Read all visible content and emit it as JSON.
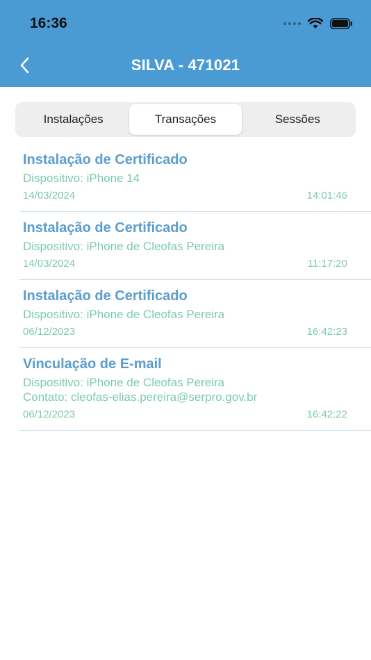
{
  "status": {
    "time": "16:36"
  },
  "header": {
    "title": "SILVA - 471021"
  },
  "tabs": [
    {
      "label": "Instalações"
    },
    {
      "label": "Transações"
    },
    {
      "label": "Sessões"
    }
  ],
  "active_tab": "Transações",
  "colors": {
    "header": "#4a9ad4",
    "title": "#5b9dcf",
    "detail": "#7ccba9"
  },
  "items": [
    {
      "title": "Instalação de Certificado",
      "device": "Dispositivo: iPhone 14",
      "date": "14/03/2024",
      "time": "14:01:46"
    },
    {
      "title": "Instalação de Certificado",
      "device": "Dispositivo: iPhone de Cleofas Pereira",
      "date": "14/03/2024",
      "time": "11:17:20"
    },
    {
      "title": "Instalação de Certificado",
      "device": "Dispositivo: iPhone de Cleofas Pereira",
      "date": "06/12/2023",
      "time": "16:42:23"
    },
    {
      "title": "Vinculação de E-mail",
      "device": "Dispositivo: iPhone de Cleofas Pereira",
      "contact": "Contato: cleofas-elias.pereira@serpro.gov.br",
      "date": "06/12/2023",
      "time": "16:42:22"
    }
  ]
}
